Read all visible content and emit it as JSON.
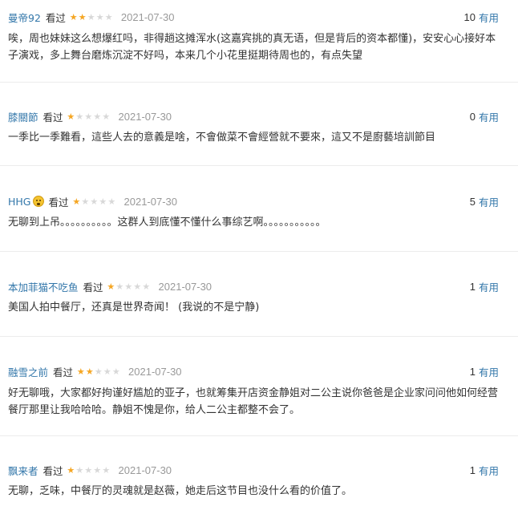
{
  "vote_label": "有用",
  "seen_label": "看过",
  "comments": [
    {
      "user": "曼帝92",
      "rating": 2,
      "date": "2021-07-30",
      "votes": "10",
      "text": "唉，周也妹妹这么想爆红吗，非得趟这摊浑水(这嘉宾挑的真无语，但是背后的资本都懂)，安安心心接好本子演戏，多上舞台磨炼沉淀不好吗，本来几个小花里挺期待周也的，有点失望"
    },
    {
      "user": "膝關節",
      "rating": 1,
      "date": "2021-07-30",
      "votes": "0",
      "text": "一季比一季難看，這些人去的意義是啥，不會做菜不會經營就不要來，這又不是廚藝培訓節目"
    },
    {
      "user": "HHG",
      "avatar_icon": "face-emoji-icon",
      "rating": 1,
      "date": "2021-07-30",
      "votes": "5",
      "text": "无聊到上吊。。。。。。。。。。这群人到底懂不懂什么事综艺啊。。。。。。。。。。。"
    },
    {
      "user": "本加菲猫不吃鱼",
      "rating": 1,
      "date": "2021-07-30",
      "votes": "1",
      "text": "美国人拍中餐厅，还真是世界奇闻！  (我说的不是宁静)"
    },
    {
      "user": "融雪之前",
      "rating": 2,
      "date": "2021-07-30",
      "votes": "1",
      "text": "好无聊哦，大家都好拘谨好尴尬的亚子，也就筹集开店资金静姐对二公主说你爸爸是企业家问问他如何经营餐厅那里让我哈哈哈。静姐不愧是你，给人二公主都整不会了。"
    },
    {
      "user": "飘来者",
      "rating": 1,
      "date": "2021-07-30",
      "votes": "1",
      "text": "无聊，乏味，中餐厅的灵魂就是赵薇，她走后这节目也没什么看的价值了。"
    }
  ],
  "colors": {
    "user_link": "#3377aa",
    "star_on": "#f5a623",
    "star_off": "#d8d8d8",
    "date": "#999999",
    "text": "#333333"
  }
}
